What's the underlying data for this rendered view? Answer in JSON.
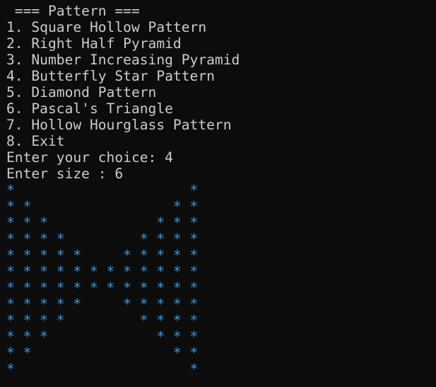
{
  "terminal": {
    "header": " === Pattern ===",
    "menu": [
      "1. Square Hollow Pattern",
      "2. Right Half Pyramid",
      "3. Number Increasing Pyramid",
      "4. Butterfly Star Pattern",
      "5. Diamond Pattern",
      "6. Pascal's Triangle",
      "7. Hollow Hourglass Pattern",
      "8. Exit"
    ],
    "choice_prompt": "Enter your choice: 4",
    "size_prompt": "Enter size : 6",
    "pattern": [
      "*                     *",
      "* *                 * *",
      "* * *             * * *",
      "* * * *         * * * *",
      "* * * * *     * * * * *",
      "* * * * * * * * * * * *",
      "* * * * * * * * * * * *",
      "* * * * *     * * * * *",
      "* * * *         * * * *",
      "* * *             * * *",
      "* *                 * *",
      "*                     *"
    ],
    "colors": {
      "background": "#0c0c0c",
      "text": "#cccccc",
      "stars": "#3a96dd"
    }
  }
}
